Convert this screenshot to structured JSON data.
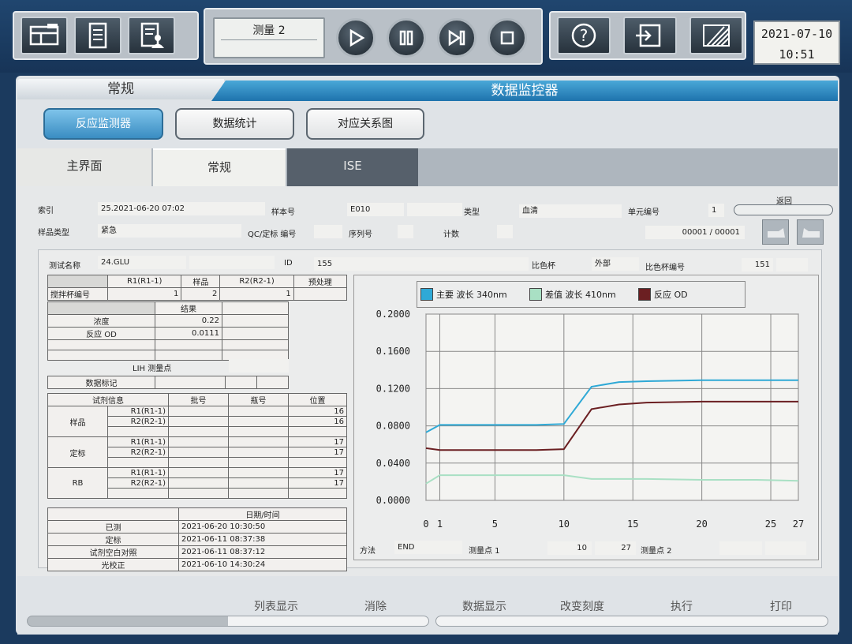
{
  "toolbar": {
    "measure_label": "测量 2",
    "date": "2021-07-10",
    "time": "10:51"
  },
  "header": {
    "left": "常规",
    "right": "数据监控器"
  },
  "mode_buttons": [
    "反应监测器",
    "数据统计",
    "对应关系图"
  ],
  "tabs": [
    "主界面",
    "常规",
    "ISE"
  ],
  "info": {
    "index_label": "索引",
    "index_value": "25.2021-06-20 07:02",
    "sample_no_label": "样本号",
    "sample_no_value": "E010",
    "type_label": "类型",
    "type_value": "血清",
    "unit_no_label": "单元编号",
    "unit_no_value": "1",
    "return_label": "返回",
    "sample_type_label": "样品类型",
    "sample_type_value": "紧急",
    "qc_label": "QC/定标 编号",
    "seq_label": "序列号",
    "count_label": "计数",
    "page_value": "00001 / 00001"
  },
  "test": {
    "name_label": "测试名称",
    "name_value": "24.GLU",
    "id_label": "ID",
    "id_value": "155",
    "cuvette_label": "比色杯",
    "cuvette_value": "外部",
    "cuvette_no_label": "比色杯编号",
    "cuvette_no_value": "151"
  },
  "stir_table": {
    "headers": [
      "",
      "R1(R1-1)",
      "样品",
      "R2(R2-1)",
      "预处理"
    ],
    "row_label": "搅拌杯编号",
    "values": [
      "1",
      "2",
      "1",
      ""
    ]
  },
  "result_table": {
    "header": "结果",
    "rows": [
      {
        "label": "浓度",
        "value": "0.22"
      },
      {
        "label": "反应 OD",
        "value": "0.0111"
      }
    ]
  },
  "lih_label": "LIH 测量点",
  "data_mark_label": "数据标记",
  "reagent_table": {
    "headers": [
      "试剂信息",
      "批号",
      "瓶号",
      "位置"
    ],
    "groups": [
      {
        "name": "样品",
        "rows": [
          {
            "r": "R1(R1-1)",
            "pos": "16"
          },
          {
            "r": "R2(R2-1)",
            "pos": "16"
          }
        ]
      },
      {
        "name": "定标",
        "rows": [
          {
            "r": "R1(R1-1)",
            "pos": "17"
          },
          {
            "r": "R2(R2-1)",
            "pos": "17"
          }
        ]
      },
      {
        "name": "RB",
        "rows": [
          {
            "r": "R1(R1-1)",
            "pos": "17"
          },
          {
            "r": "R2(R2-1)",
            "pos": "17"
          }
        ]
      }
    ]
  },
  "date_table": {
    "header": "日期/时间",
    "rows": [
      {
        "label": "已测",
        "value": "2021-06-20 10:30:50"
      },
      {
        "label": "定标",
        "value": "2021-06-11 08:37:38"
      },
      {
        "label": "试剂空白对照",
        "value": "2021-06-11 08:37:12"
      },
      {
        "label": "光校正",
        "value": "2021-06-10 14:30:24"
      }
    ]
  },
  "method": {
    "method_label": "方法",
    "method_value": "END",
    "point1_label": "测量点 1",
    "point1_a": "10",
    "point1_b": "27",
    "point2_label": "测量点 2"
  },
  "colors": {
    "main": "#2fa9d6",
    "diff": "#a9e0c4",
    "reaction": "#6b1f22"
  },
  "chart_data": {
    "type": "line",
    "legend": [
      "主要 波长 340nm",
      "差值 波长 410nm",
      "反应 OD"
    ],
    "x_ticks": [
      0,
      1,
      5,
      10,
      15,
      20,
      25,
      27
    ],
    "y_ticks": [
      "0.2000",
      "0.1600",
      "0.1200",
      "0.0800",
      "0.0400",
      "0.0000"
    ],
    "xlim": [
      0,
      27
    ],
    "ylim": [
      0,
      0.2
    ],
    "series": [
      {
        "name": "主要 波长 340nm",
        "x": [
          0,
          1,
          2,
          5,
          8,
          10,
          12,
          14,
          16,
          20,
          24,
          27
        ],
        "values": [
          0.073,
          0.081,
          0.081,
          0.081,
          0.081,
          0.082,
          0.122,
          0.127,
          0.128,
          0.129,
          0.129,
          0.129
        ]
      },
      {
        "name": "差值 波长 410nm",
        "x": [
          0,
          1,
          2,
          5,
          8,
          10,
          12,
          14,
          16,
          20,
          24,
          27
        ],
        "values": [
          0.018,
          0.027,
          0.027,
          0.027,
          0.027,
          0.027,
          0.023,
          0.023,
          0.023,
          0.022,
          0.022,
          0.021
        ]
      },
      {
        "name": "反应 OD",
        "x": [
          0,
          1,
          2,
          5,
          8,
          10,
          12,
          14,
          16,
          20,
          24,
          27
        ],
        "values": [
          0.056,
          0.054,
          0.054,
          0.054,
          0.054,
          0.055,
          0.098,
          0.103,
          0.105,
          0.106,
          0.106,
          0.106
        ]
      }
    ]
  },
  "bottom_buttons": [
    "列表显示",
    "消除",
    "数据显示",
    "改变刻度",
    "执行",
    "打印"
  ]
}
